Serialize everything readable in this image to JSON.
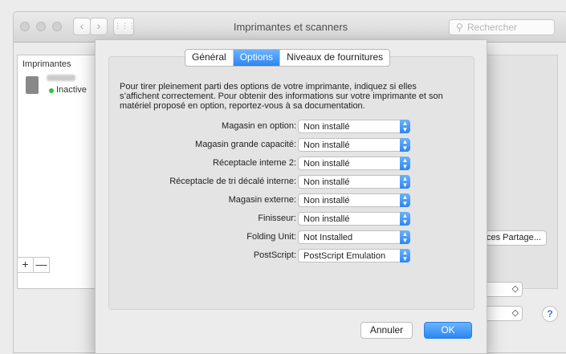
{
  "window": {
    "title": "Imprimantes et scanners",
    "search_placeholder": "Rechercher",
    "nav_back": "‹",
    "nav_forward": "›",
    "grid_icon": "⋮⋮⋮"
  },
  "printers_panel": {
    "header": "Imprimantes",
    "status": "Inactive",
    "add": "+",
    "remove": "—"
  },
  "background": {
    "share_button": "ces Partage...",
    "help": "?",
    "select_arrow": "◇"
  },
  "sheet": {
    "tabs": [
      {
        "label": "Général",
        "active": false
      },
      {
        "label": "Options",
        "active": true
      },
      {
        "label": "Niveaux de fournitures",
        "active": false
      }
    ],
    "description": "Pour tirer pleinement parti des options de votre imprimante, indiquez si elles s’affichent correctement. Pour obtenir des informations sur votre imprimante et son matériel proposé en option, reportez-vous à sa documentation.",
    "options": [
      {
        "label": "Magasin en option:",
        "value": "Non installé"
      },
      {
        "label": "Magasin grande capacité:",
        "value": "Non installé"
      },
      {
        "label": "Réceptacle interne 2:",
        "value": "Non installé"
      },
      {
        "label": "Réceptacle de tri décalé interne:",
        "value": "Non installé"
      },
      {
        "label": "Magasin externe:",
        "value": "Non installé"
      },
      {
        "label": "Finisseur:",
        "value": "Non installé"
      },
      {
        "label": "Folding Unit:",
        "value": "Not Installed"
      },
      {
        "label": "PostScript:",
        "value": "PostScript Emulation"
      }
    ],
    "cancel_label": "Annuler",
    "ok_label": "OK"
  },
  "colors": {
    "accent": "#2b86f4",
    "status_green": "#32c03a"
  }
}
